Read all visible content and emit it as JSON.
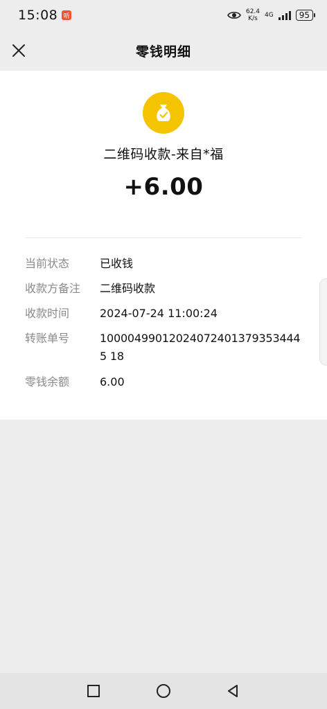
{
  "status_bar": {
    "time": "15:08",
    "app_badge": "听",
    "net_speed_value": "62.4",
    "net_speed_unit": "K/s",
    "network": "4G",
    "battery": "95"
  },
  "header": {
    "title": "零钱明细"
  },
  "transaction": {
    "title": "二维码收款-来自*福",
    "amount": "+6.00",
    "icon": "money-bag-icon",
    "icon_color": "#f5c400"
  },
  "details": [
    {
      "label": "当前状态",
      "value": "已收钱"
    },
    {
      "label": "收款方备注",
      "value": "二维码收款"
    },
    {
      "label": "收款时间",
      "value": "2024-07-24 11:00:24"
    },
    {
      "label": "转账单号",
      "value": "100004990120240724013793534445 18"
    },
    {
      "label": "零钱余额",
      "value": "6.00"
    }
  ],
  "nav": {
    "recent": "square-icon",
    "home": "circle-icon",
    "back": "triangle-back-icon"
  }
}
